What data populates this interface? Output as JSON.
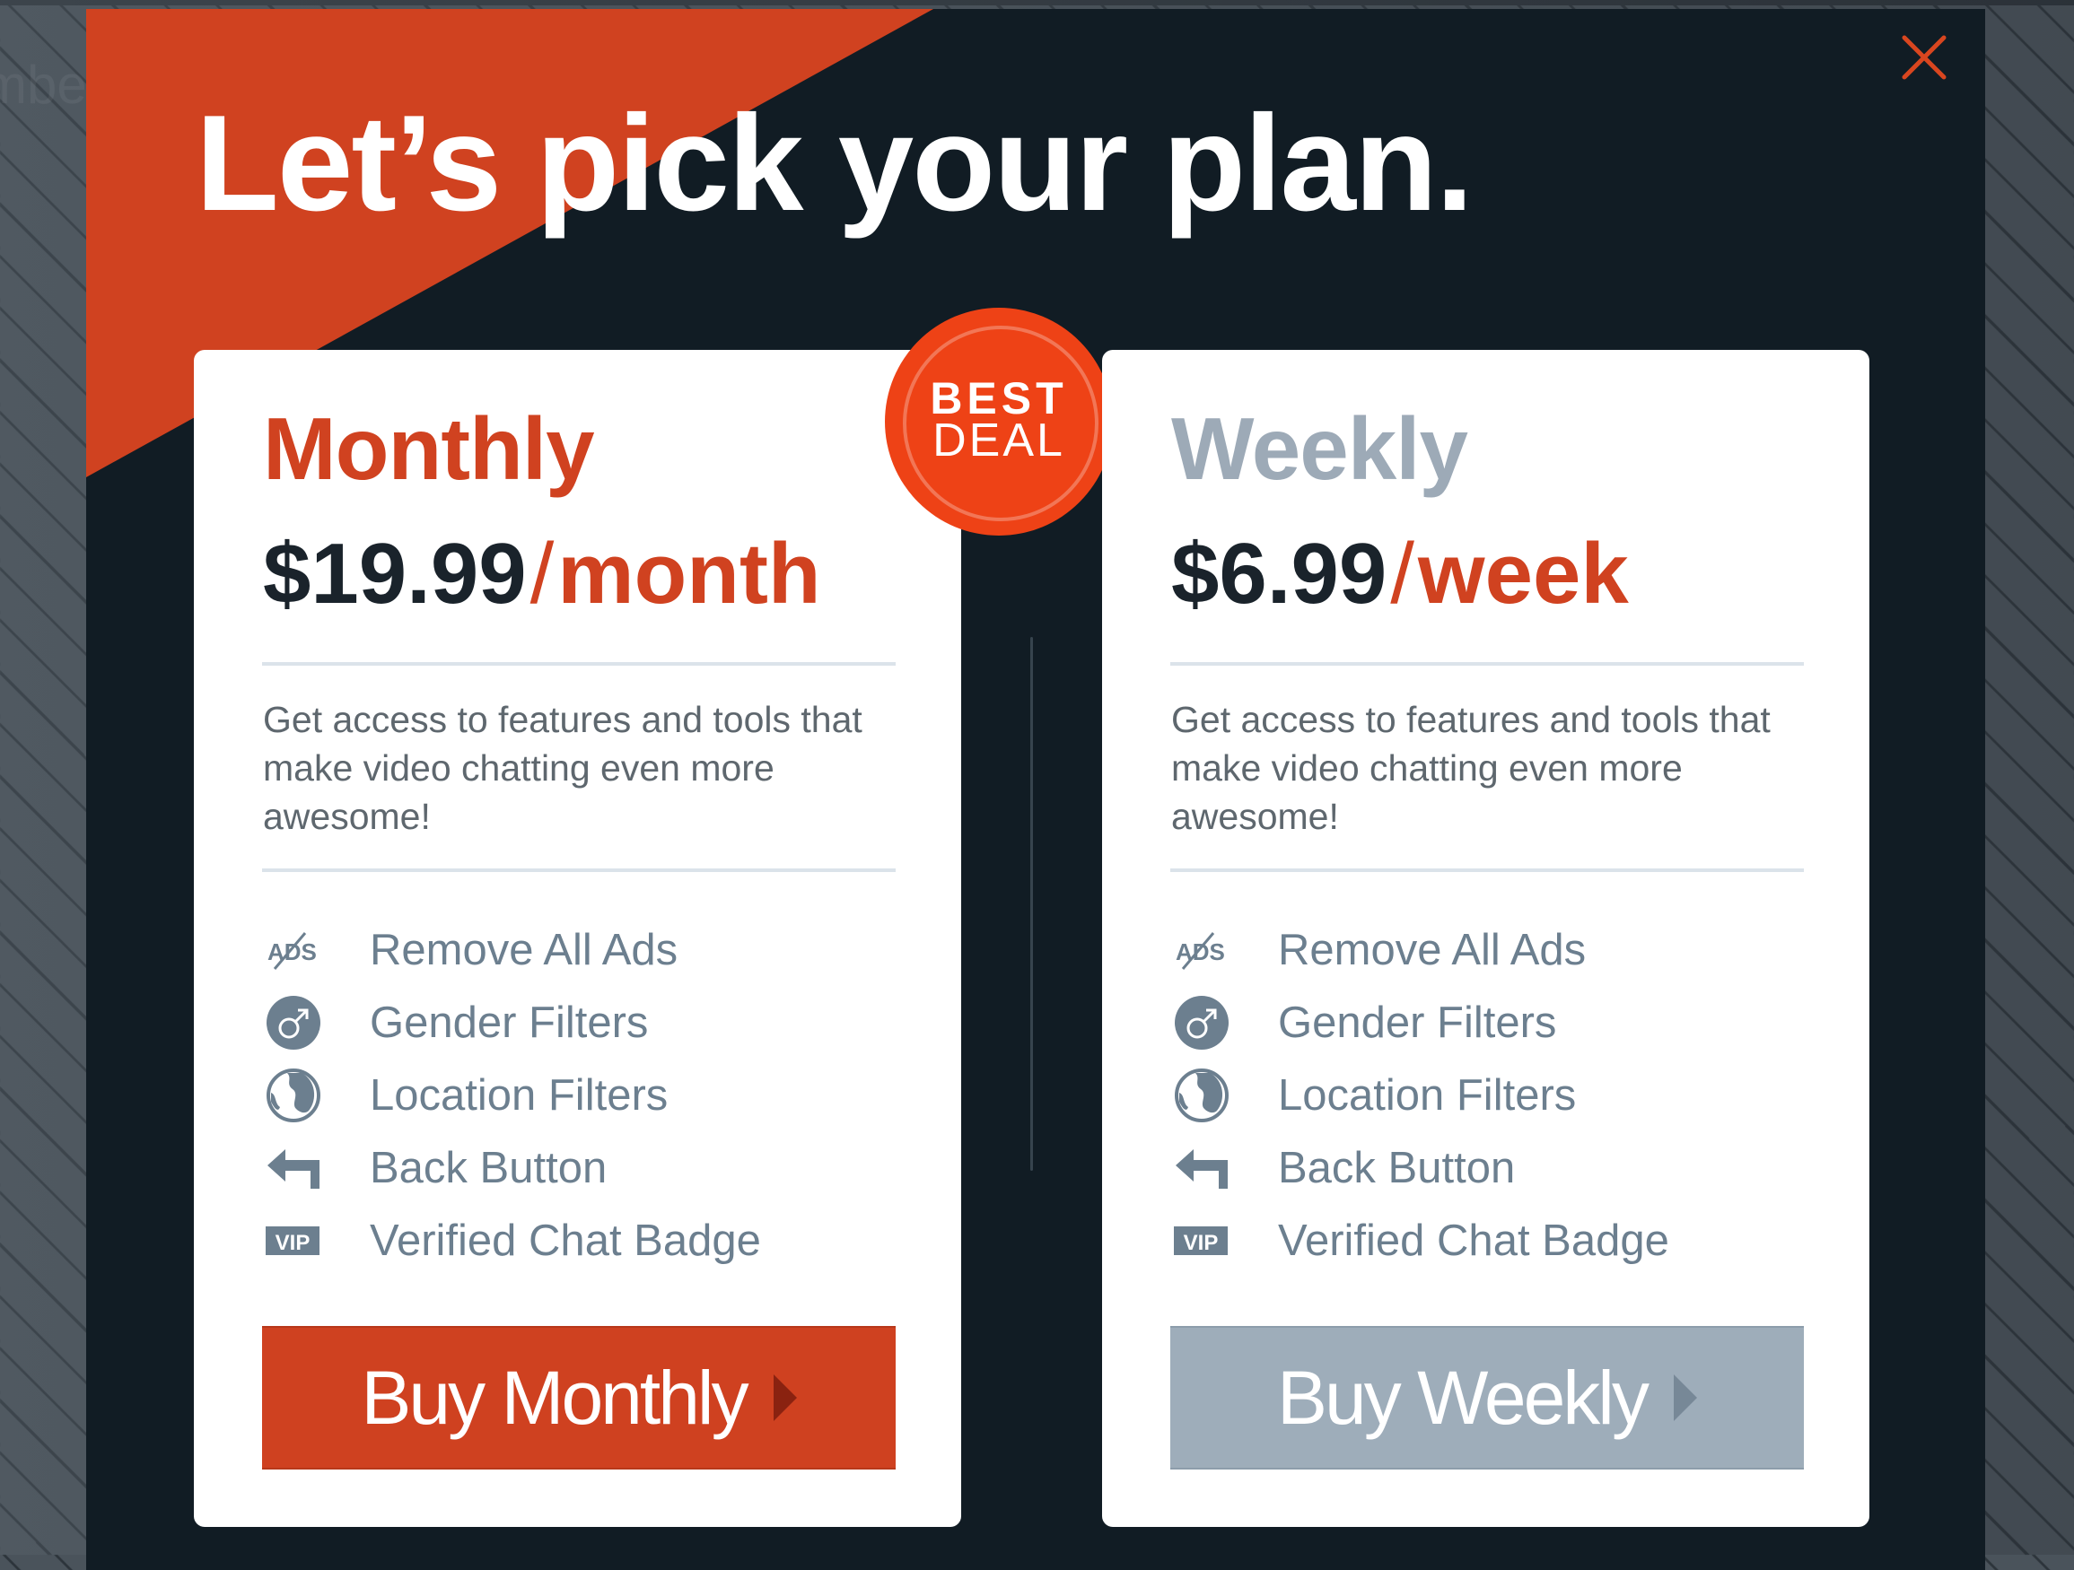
{
  "background": {
    "ghost_text": "mbers"
  },
  "modal": {
    "title": "Let’s pick your plan.",
    "close_icon": "close-icon",
    "colors": {
      "accent": "#d04220",
      "dark_bg": "#111c24",
      "badge": "#ee4216",
      "muted": "#9eadba",
      "feature_text": "#6c7f8f"
    }
  },
  "plans": [
    {
      "id": "monthly",
      "name": "Monthly",
      "price": "$19.99",
      "separator": "/",
      "period": "month",
      "description": "Get access to features and tools that make video chatting even more awesome!",
      "badge": {
        "line1": "BEST",
        "line2": "DEAL"
      },
      "features": [
        {
          "icon": "no-ads-icon",
          "label": "Remove All Ads"
        },
        {
          "icon": "gender-icon",
          "label": "Gender Filters"
        },
        {
          "icon": "globe-icon",
          "label": "Location Filters"
        },
        {
          "icon": "back-arrow-icon",
          "label": "Back Button"
        },
        {
          "icon": "vip-icon",
          "label": "Verified Chat Badge"
        }
      ],
      "button_label": "Buy Monthly"
    },
    {
      "id": "weekly",
      "name": "Weekly",
      "price": "$6.99",
      "separator": "/",
      "period": "week",
      "description": "Get access to features and tools that make video chatting even more awesome!",
      "features": [
        {
          "icon": "no-ads-icon",
          "label": "Remove All Ads"
        },
        {
          "icon": "gender-icon",
          "label": "Gender Filters"
        },
        {
          "icon": "globe-icon",
          "label": "Location Filters"
        },
        {
          "icon": "back-arrow-icon",
          "label": "Back Button"
        },
        {
          "icon": "vip-icon",
          "label": "Verified Chat Badge"
        }
      ],
      "button_label": "Buy Weekly"
    }
  ]
}
